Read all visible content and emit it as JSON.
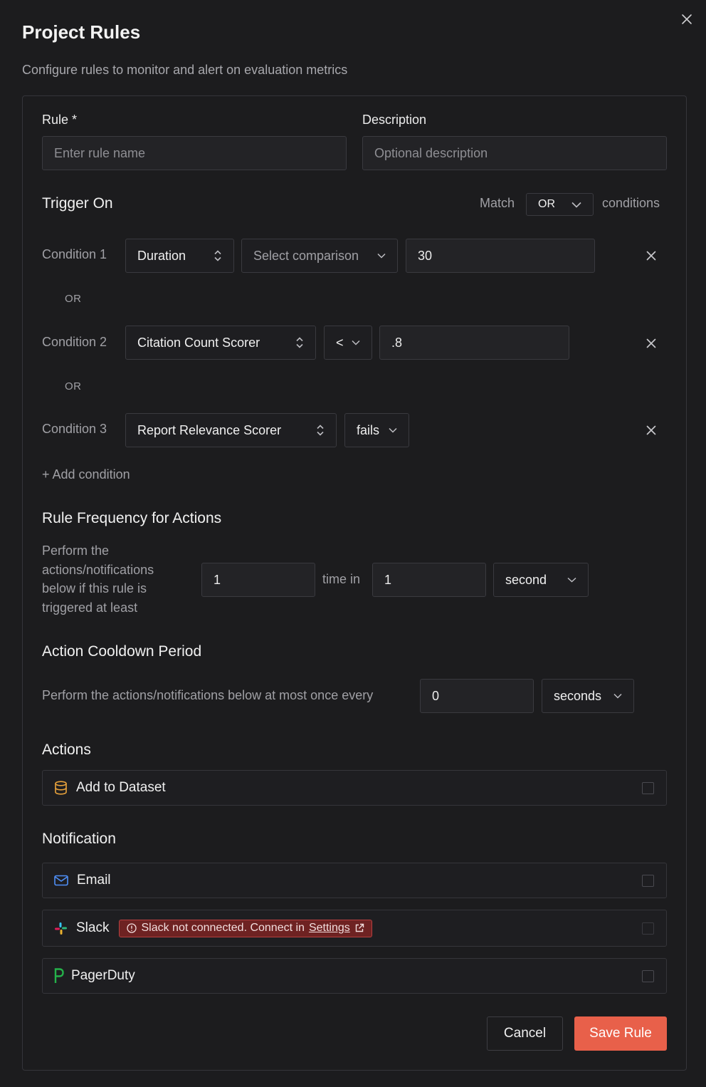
{
  "dialog": {
    "title": "Project Rules",
    "subtitle": "Configure rules to monitor and alert on evaluation metrics"
  },
  "rule": {
    "label": "Rule *",
    "placeholder": "Enter rule name",
    "value": ""
  },
  "description": {
    "label": "Description",
    "placeholder": "Optional description",
    "value": ""
  },
  "trigger": {
    "title": "Trigger On",
    "match_label": "Match",
    "match_value": "OR",
    "conditions_label": "conditions",
    "conditions": [
      {
        "label": "Condition 1",
        "metric": "Duration",
        "comparison": "Select comparison",
        "value": "30"
      },
      {
        "label": "Condition 2",
        "metric": "Citation Count Scorer",
        "comparison": "<",
        "value": ".8"
      },
      {
        "label": "Condition 3",
        "metric": "Report Relevance Scorer",
        "comparison": "fails"
      }
    ],
    "joiner": "OR",
    "add_condition": "+ Add condition"
  },
  "frequency": {
    "title": "Rule Frequency for Actions",
    "description": "Perform the actions/notifications below if this rule is triggered at least",
    "count": "1",
    "time_in_label": "time in",
    "period": "1",
    "unit": "second"
  },
  "cooldown": {
    "title": "Action Cooldown Period",
    "description": "Perform the actions/notifications below at most once every",
    "value": "0",
    "unit": "seconds"
  },
  "actions": {
    "title": "Actions",
    "items": [
      {
        "label": "Add to Dataset",
        "icon": "database-icon",
        "checked": false
      }
    ]
  },
  "notification": {
    "title": "Notification",
    "email": {
      "label": "Email",
      "icon": "mail-icon"
    },
    "slack": {
      "label": "Slack",
      "icon": "slack-icon",
      "warning_text": "Slack not connected. Connect in",
      "warning_link": "Settings"
    },
    "pagerduty": {
      "label": "PagerDuty",
      "icon": "pagerduty-icon"
    }
  },
  "footer": {
    "cancel": "Cancel",
    "save": "Save Rule"
  },
  "colors": {
    "accent": "#e8604a",
    "warning_bg": "#6e2222",
    "dataset_icon": "#e9a23b",
    "email_icon": "#4f8ff7",
    "pagerduty_icon": "#25b14a"
  }
}
